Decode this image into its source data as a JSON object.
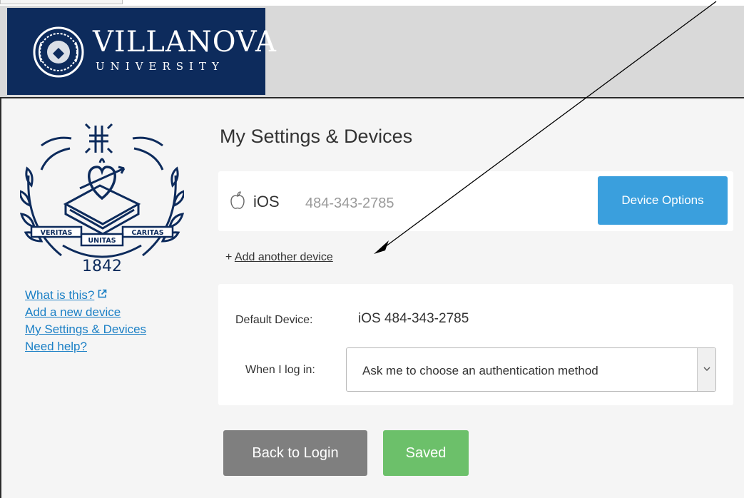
{
  "header": {
    "logo_word": "VILLANOVA",
    "logo_sub": "UNIVERSITY"
  },
  "seal": {
    "motto_left": "VERITAS",
    "motto_center": "UNITAS",
    "motto_right": "CARITAS",
    "year": "1842"
  },
  "sidebar": {
    "links": [
      {
        "label": "What is this?"
      },
      {
        "label": "Add a new device"
      },
      {
        "label": "My Settings & Devices"
      },
      {
        "label": "Need help?"
      }
    ]
  },
  "main": {
    "title": "My Settings & Devices",
    "device": {
      "os": "iOS",
      "number": "484-343-2785",
      "options_label": "Device Options"
    },
    "add_device": {
      "prefix": "+ ",
      "label": "Add another device"
    },
    "settings": {
      "default_label": "Default Device:",
      "default_value": "iOS 484-343-2785",
      "login_label": "When I log in:",
      "login_selected": "Ask me to choose an authentication method"
    },
    "buttons": {
      "back_label": "Back to Login",
      "saved_label": "Saved"
    }
  },
  "colors": {
    "brand_navy": "#0d2b5c",
    "link_blue": "#1a7fc5",
    "options_blue": "#3a9fdd",
    "saved_green": "#6cc06a",
    "back_gray": "#7f7f7f"
  }
}
